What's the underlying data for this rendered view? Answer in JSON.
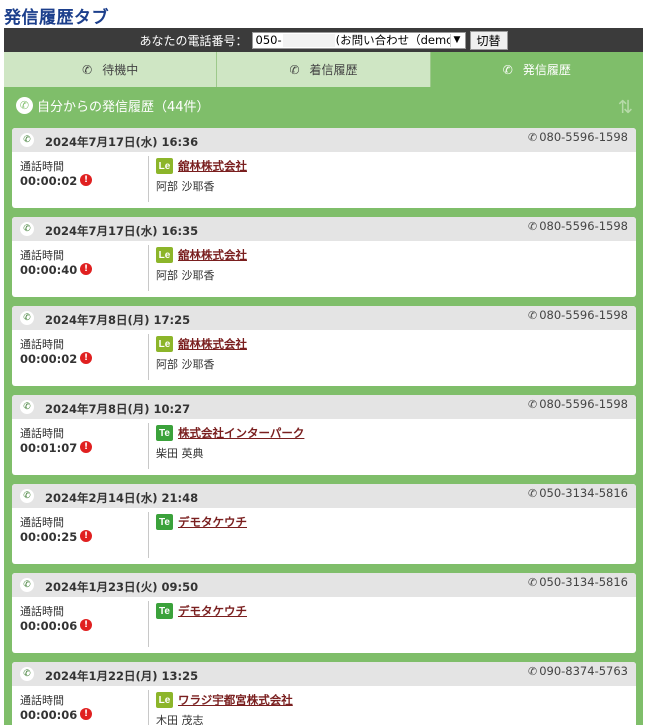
{
  "page": {
    "title": "発信履歴タブ"
  },
  "topbar": {
    "phone_label": "あなたの電話番号：",
    "phone_prefix": "050-",
    "phone_suffix": "(お問い合わせ（demo)",
    "switch_label": "切替"
  },
  "tabs": [
    {
      "label": "待機中",
      "icon": "phone-icon"
    },
    {
      "label": "着信履歴",
      "icon": "incoming-call-icon"
    },
    {
      "label": "発信履歴",
      "icon": "outgoing-call-icon"
    }
  ],
  "section": {
    "title": "自分からの発信履歴（44件）"
  },
  "records": [
    {
      "date": "2024年7月17日(水) 16:36",
      "number": "080-5596-1598",
      "duration_label": "通話時間",
      "duration": "00:00:02",
      "badge": "Le",
      "company": "舘林株式会社",
      "contact": "阿部 沙耶香"
    },
    {
      "date": "2024年7月17日(水) 16:35",
      "number": "080-5596-1598",
      "duration_label": "通話時間",
      "duration": "00:00:40",
      "badge": "Le",
      "company": "舘林株式会社",
      "contact": "阿部 沙耶香"
    },
    {
      "date": "2024年7月8日(月) 17:25",
      "number": "080-5596-1598",
      "duration_label": "通話時間",
      "duration": "00:00:02",
      "badge": "Le",
      "company": "舘林株式会社",
      "contact": "阿部 沙耶香"
    },
    {
      "date": "2024年7月8日(月) 10:27",
      "number": "080-5596-1598",
      "duration_label": "通話時間",
      "duration": "00:01:07",
      "badge": "Te",
      "company": "株式会社インターパーク",
      "contact": "柴田 英典"
    },
    {
      "date": "2024年2月14日(水) 21:48",
      "number": "050-3134-5816",
      "duration_label": "通話時間",
      "duration": "00:00:25",
      "badge": "Te",
      "company": "デモタケウチ",
      "contact": ""
    },
    {
      "date": "2024年1月23日(火) 09:50",
      "number": "050-3134-5816",
      "duration_label": "通話時間",
      "duration": "00:00:06",
      "badge": "Te",
      "company": "デモタケウチ",
      "contact": ""
    },
    {
      "date": "2024年1月22日(月) 13:25",
      "number": "090-8374-5763",
      "duration_label": "通話時間",
      "duration": "00:00:06",
      "badge": "Le",
      "company": "ワラジ宇都宮株式会社",
      "contact": "木田 茂志"
    }
  ],
  "colors": {
    "title": "#1c3f8c",
    "frame_green": "#7fbe6a",
    "badge_le": "#8cb52a",
    "badge_te": "#3ba23b",
    "company_link": "#7a1f1f",
    "record_icon": "#e02020"
  }
}
